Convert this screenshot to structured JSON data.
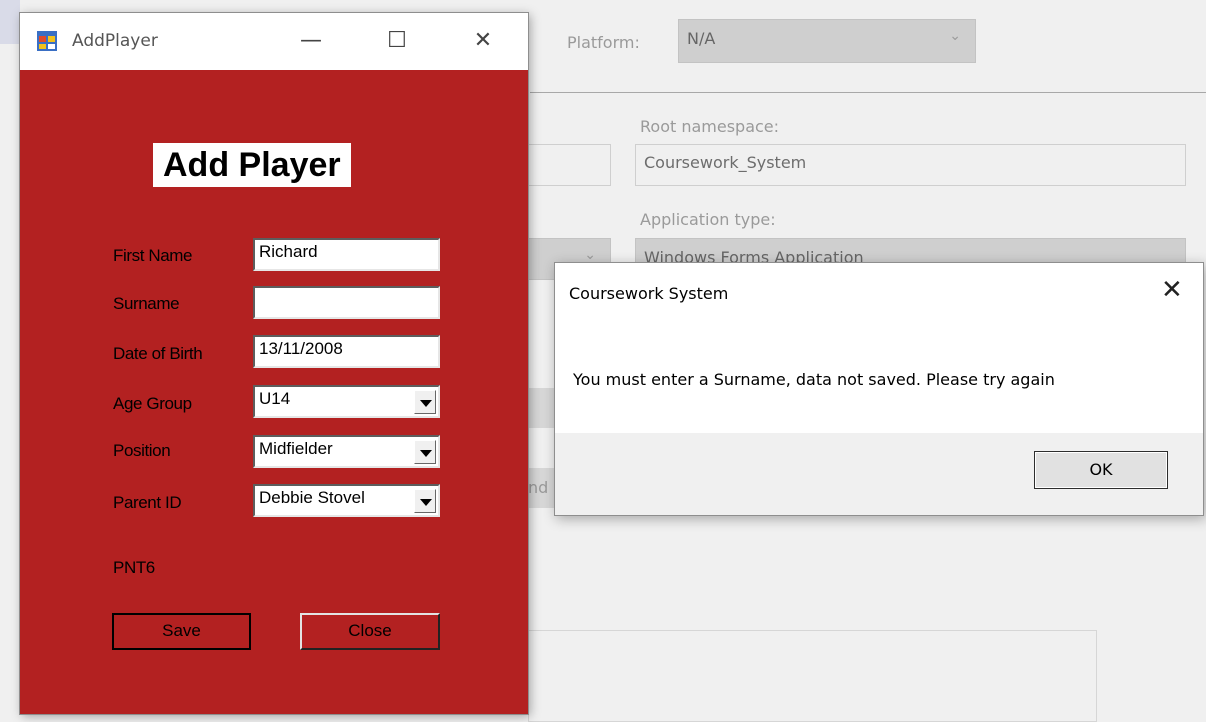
{
  "background": {
    "platform_label": "Platform:",
    "platform_value": "N/A",
    "root_namespace_label": "Root namespace:",
    "root_namespace_value": "Coursework_System",
    "application_type_label": "Application type:",
    "application_type_value": "Windows Forms Application",
    "hidden_button_fragment": "nd"
  },
  "window": {
    "title": "AddPlayer",
    "minimize_glyph": "—",
    "maximize_glyph": "☐",
    "close_glyph": "✕",
    "background_color": "#b32121"
  },
  "form": {
    "heading": "Add Player",
    "fields": {
      "first_name": {
        "label": "First Name",
        "value": "Richard"
      },
      "surname": {
        "label": "Surname",
        "value": ""
      },
      "dob": {
        "label": "Date of Birth",
        "value": "13/11/2008"
      },
      "age_group": {
        "label": "Age Group",
        "value": "U14"
      },
      "position": {
        "label": "Position",
        "value": "Midfielder"
      },
      "parent_id": {
        "label": "Parent ID",
        "value": "Debbie Stovel"
      }
    },
    "parent_code": "PNT6",
    "save_label": "Save",
    "close_label": "Close"
  },
  "dialog": {
    "title": "Coursework System",
    "close_glyph": "✕",
    "message": "You must enter a Surname, data not saved. Please try again",
    "ok_label": "OK"
  },
  "icons": [
    "app-form-icon",
    "close-icon",
    "minimize-icon",
    "maximize-icon",
    "dropdown-arrow-icon",
    "chevron-down-icon"
  ]
}
